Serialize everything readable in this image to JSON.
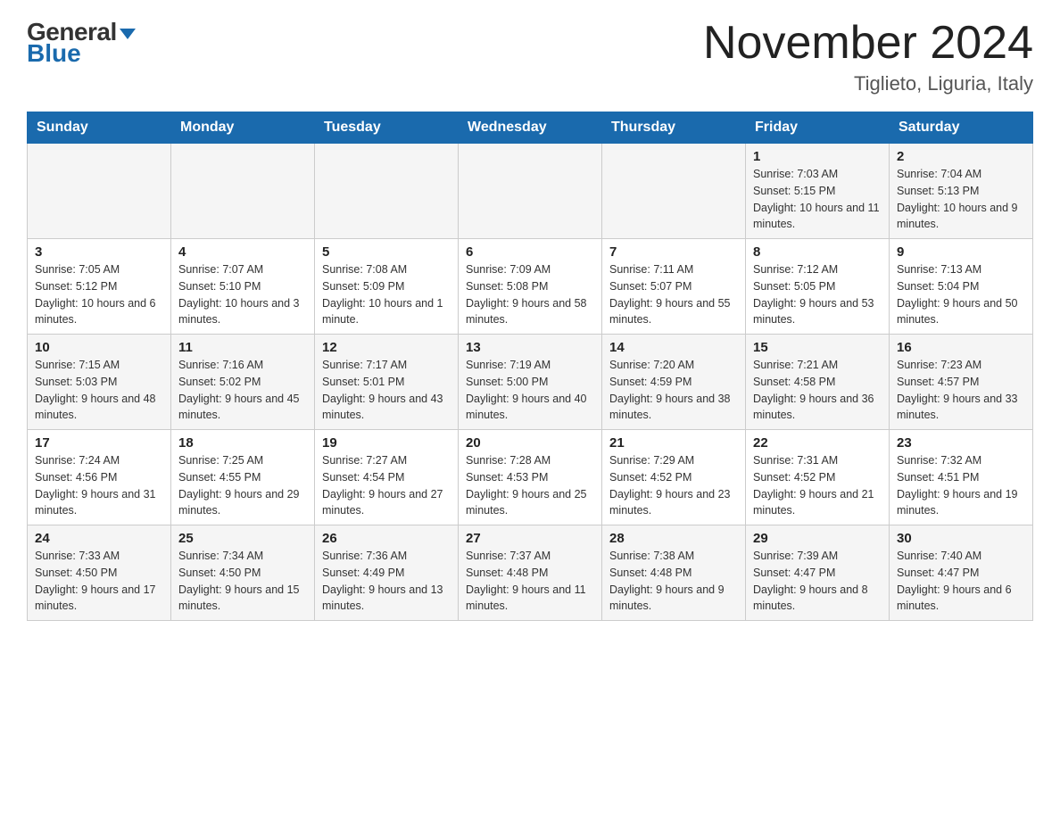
{
  "header": {
    "logo_general": "General",
    "logo_blue": "Blue",
    "month_title": "November 2024",
    "location": "Tiglieto, Liguria, Italy"
  },
  "weekdays": [
    "Sunday",
    "Monday",
    "Tuesday",
    "Wednesday",
    "Thursday",
    "Friday",
    "Saturday"
  ],
  "weeks": [
    [
      {
        "day": "",
        "sunrise": "",
        "sunset": "",
        "daylight": ""
      },
      {
        "day": "",
        "sunrise": "",
        "sunset": "",
        "daylight": ""
      },
      {
        "day": "",
        "sunrise": "",
        "sunset": "",
        "daylight": ""
      },
      {
        "day": "",
        "sunrise": "",
        "sunset": "",
        "daylight": ""
      },
      {
        "day": "",
        "sunrise": "",
        "sunset": "",
        "daylight": ""
      },
      {
        "day": "1",
        "sunrise": "Sunrise: 7:03 AM",
        "sunset": "Sunset: 5:15 PM",
        "daylight": "Daylight: 10 hours and 11 minutes."
      },
      {
        "day": "2",
        "sunrise": "Sunrise: 7:04 AM",
        "sunset": "Sunset: 5:13 PM",
        "daylight": "Daylight: 10 hours and 9 minutes."
      }
    ],
    [
      {
        "day": "3",
        "sunrise": "Sunrise: 7:05 AM",
        "sunset": "Sunset: 5:12 PM",
        "daylight": "Daylight: 10 hours and 6 minutes."
      },
      {
        "day": "4",
        "sunrise": "Sunrise: 7:07 AM",
        "sunset": "Sunset: 5:10 PM",
        "daylight": "Daylight: 10 hours and 3 minutes."
      },
      {
        "day": "5",
        "sunrise": "Sunrise: 7:08 AM",
        "sunset": "Sunset: 5:09 PM",
        "daylight": "Daylight: 10 hours and 1 minute."
      },
      {
        "day": "6",
        "sunrise": "Sunrise: 7:09 AM",
        "sunset": "Sunset: 5:08 PM",
        "daylight": "Daylight: 9 hours and 58 minutes."
      },
      {
        "day": "7",
        "sunrise": "Sunrise: 7:11 AM",
        "sunset": "Sunset: 5:07 PM",
        "daylight": "Daylight: 9 hours and 55 minutes."
      },
      {
        "day": "8",
        "sunrise": "Sunrise: 7:12 AM",
        "sunset": "Sunset: 5:05 PM",
        "daylight": "Daylight: 9 hours and 53 minutes."
      },
      {
        "day": "9",
        "sunrise": "Sunrise: 7:13 AM",
        "sunset": "Sunset: 5:04 PM",
        "daylight": "Daylight: 9 hours and 50 minutes."
      }
    ],
    [
      {
        "day": "10",
        "sunrise": "Sunrise: 7:15 AM",
        "sunset": "Sunset: 5:03 PM",
        "daylight": "Daylight: 9 hours and 48 minutes."
      },
      {
        "day": "11",
        "sunrise": "Sunrise: 7:16 AM",
        "sunset": "Sunset: 5:02 PM",
        "daylight": "Daylight: 9 hours and 45 minutes."
      },
      {
        "day": "12",
        "sunrise": "Sunrise: 7:17 AM",
        "sunset": "Sunset: 5:01 PM",
        "daylight": "Daylight: 9 hours and 43 minutes."
      },
      {
        "day": "13",
        "sunrise": "Sunrise: 7:19 AM",
        "sunset": "Sunset: 5:00 PM",
        "daylight": "Daylight: 9 hours and 40 minutes."
      },
      {
        "day": "14",
        "sunrise": "Sunrise: 7:20 AM",
        "sunset": "Sunset: 4:59 PM",
        "daylight": "Daylight: 9 hours and 38 minutes."
      },
      {
        "day": "15",
        "sunrise": "Sunrise: 7:21 AM",
        "sunset": "Sunset: 4:58 PM",
        "daylight": "Daylight: 9 hours and 36 minutes."
      },
      {
        "day": "16",
        "sunrise": "Sunrise: 7:23 AM",
        "sunset": "Sunset: 4:57 PM",
        "daylight": "Daylight: 9 hours and 33 minutes."
      }
    ],
    [
      {
        "day": "17",
        "sunrise": "Sunrise: 7:24 AM",
        "sunset": "Sunset: 4:56 PM",
        "daylight": "Daylight: 9 hours and 31 minutes."
      },
      {
        "day": "18",
        "sunrise": "Sunrise: 7:25 AM",
        "sunset": "Sunset: 4:55 PM",
        "daylight": "Daylight: 9 hours and 29 minutes."
      },
      {
        "day": "19",
        "sunrise": "Sunrise: 7:27 AM",
        "sunset": "Sunset: 4:54 PM",
        "daylight": "Daylight: 9 hours and 27 minutes."
      },
      {
        "day": "20",
        "sunrise": "Sunrise: 7:28 AM",
        "sunset": "Sunset: 4:53 PM",
        "daylight": "Daylight: 9 hours and 25 minutes."
      },
      {
        "day": "21",
        "sunrise": "Sunrise: 7:29 AM",
        "sunset": "Sunset: 4:52 PM",
        "daylight": "Daylight: 9 hours and 23 minutes."
      },
      {
        "day": "22",
        "sunrise": "Sunrise: 7:31 AM",
        "sunset": "Sunset: 4:52 PM",
        "daylight": "Daylight: 9 hours and 21 minutes."
      },
      {
        "day": "23",
        "sunrise": "Sunrise: 7:32 AM",
        "sunset": "Sunset: 4:51 PM",
        "daylight": "Daylight: 9 hours and 19 minutes."
      }
    ],
    [
      {
        "day": "24",
        "sunrise": "Sunrise: 7:33 AM",
        "sunset": "Sunset: 4:50 PM",
        "daylight": "Daylight: 9 hours and 17 minutes."
      },
      {
        "day": "25",
        "sunrise": "Sunrise: 7:34 AM",
        "sunset": "Sunset: 4:50 PM",
        "daylight": "Daylight: 9 hours and 15 minutes."
      },
      {
        "day": "26",
        "sunrise": "Sunrise: 7:36 AM",
        "sunset": "Sunset: 4:49 PM",
        "daylight": "Daylight: 9 hours and 13 minutes."
      },
      {
        "day": "27",
        "sunrise": "Sunrise: 7:37 AM",
        "sunset": "Sunset: 4:48 PM",
        "daylight": "Daylight: 9 hours and 11 minutes."
      },
      {
        "day": "28",
        "sunrise": "Sunrise: 7:38 AM",
        "sunset": "Sunset: 4:48 PM",
        "daylight": "Daylight: 9 hours and 9 minutes."
      },
      {
        "day": "29",
        "sunrise": "Sunrise: 7:39 AM",
        "sunset": "Sunset: 4:47 PM",
        "daylight": "Daylight: 9 hours and 8 minutes."
      },
      {
        "day": "30",
        "sunrise": "Sunrise: 7:40 AM",
        "sunset": "Sunset: 4:47 PM",
        "daylight": "Daylight: 9 hours and 6 minutes."
      }
    ]
  ]
}
